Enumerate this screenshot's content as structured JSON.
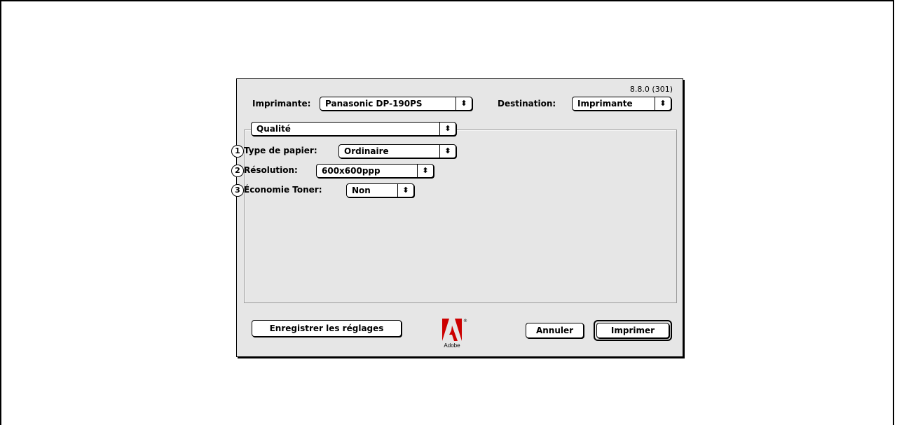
{
  "dialog": {
    "version": "8.8.0 (301)",
    "printer_label": "Imprimante:",
    "printer_value": "Panasonic DP-190PS",
    "destination_label": "Destination:",
    "destination_value": "Imprimante",
    "section_value": "Qualité",
    "arrow_glyph": "⬍"
  },
  "options": [
    {
      "number": "1",
      "label": "Type de papier:",
      "value": "Ordinaire"
    },
    {
      "number": "2",
      "label": "Résolution:",
      "value": "600x600ppp"
    },
    {
      "number": "3",
      "label": "Économie Toner:",
      "value": "Non"
    }
  ],
  "buttons": {
    "save": "Enregistrer les réglages",
    "cancel": "Annuler",
    "print": "Imprimer"
  },
  "logo": {
    "text": "Adobe",
    "mark": "®",
    "color": "#cc0000"
  }
}
